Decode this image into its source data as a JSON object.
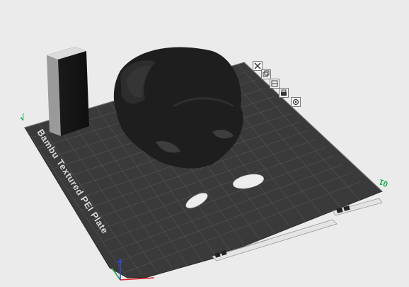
{
  "plate": {
    "name": "Bambu Textured PEI Plate",
    "left_marker": "√",
    "right_marker": "01"
  },
  "colors": {
    "background": "#ebebeb",
    "plate": "#3a3a3a",
    "grid": "#555555",
    "model": "#1e1e1e",
    "accent": "#00aa44",
    "axis_x": "#e02020",
    "axis_y": "#1f9a3a",
    "axis_z": "#2a4bd7"
  },
  "icons": {
    "object_toolbar": [
      "delete-icon",
      "clone-icon",
      "arrange-icon",
      "layer-icon",
      "settings-icon"
    ],
    "plate_bar": [
      "plate-number-icon",
      "lock-icon",
      "edit-icon"
    ]
  }
}
